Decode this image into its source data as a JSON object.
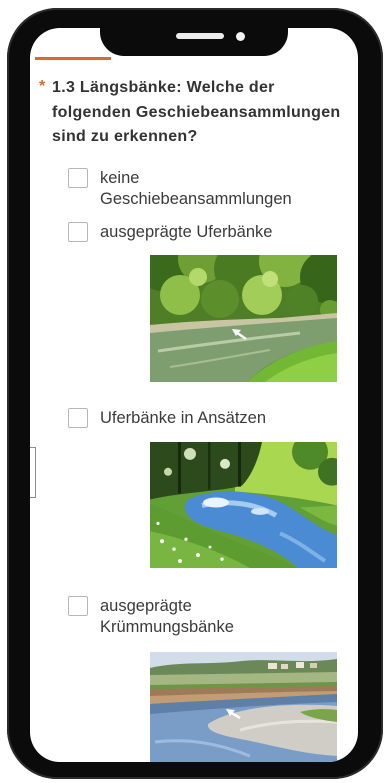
{
  "colors": {
    "accent": "#d96a2b",
    "text": "#3b3b3b",
    "checkbox_border": "#b7b7b7",
    "frame": "#0b0b0b"
  },
  "progress": {
    "fraction": 0.24
  },
  "question": {
    "required_marker": "*",
    "text": "1.3 Längsbänke: Welche der folgenden Geschiebeansammlungen sind zu erkennen?"
  },
  "options": [
    {
      "label": "keine Geschiebeansammlungen",
      "checked": false
    },
    {
      "label": "ausgeprägte Uferbänke",
      "checked": false
    },
    {
      "label": "Uferbänke in Ansätzen",
      "checked": false
    },
    {
      "label": "ausgeprägte Krümmungsbänke",
      "checked": false
    }
  ]
}
